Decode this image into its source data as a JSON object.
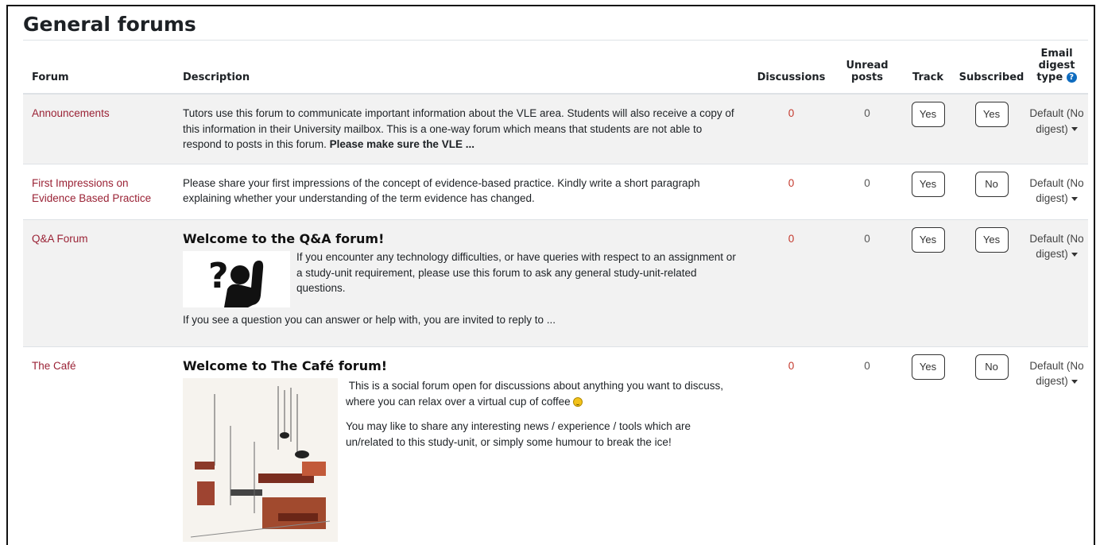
{
  "section_title": "General forums",
  "columns": {
    "forum": "Forum",
    "description": "Description",
    "discussions": "Discussions",
    "unread_line1": "Unread",
    "unread_line2": "posts",
    "track": "Track",
    "subscribed": "Subscribed",
    "digest_line1": "Email digest",
    "digest_line2": "type",
    "digest_help_icon": "question-circle-icon"
  },
  "forums": [
    {
      "name": "Announcements",
      "description_text": "Tutors use this forum to communicate important information about the VLE area. Students will also receive a copy of this information in their University mailbox. This is a one-way forum which means that students are not able to respond to posts in this forum.",
      "description_bold": "Please make sure the VLE ...",
      "discussions": "0",
      "unread": "0",
      "track": "Yes",
      "subscribed": "Yes",
      "digest": "Default (No digest)"
    },
    {
      "name": "First Impressions on Evidence Based Practice",
      "description_text": "Please share your first impressions of the concept of evidence-based practice. Kindly write a short paragraph explaining whether your understanding of the term evidence has changed.",
      "discussions": "0",
      "unread": "0",
      "track": "Yes",
      "subscribed": "No",
      "digest": "Default (No digest)"
    },
    {
      "name": "Q&A Forum",
      "heading": "Welcome to the Q&A forum!",
      "side_text": "If you encounter any technology difficulties, or have queries with respect to an assignment or a study-unit requirement, please use this forum to ask any general study-unit-related questions.",
      "footer_text": "If you see a question you can answer or help with, you are invited to reply to ...",
      "image_icon": "question-person-raising-hand-icon",
      "discussions": "0",
      "unread": "0",
      "track": "Yes",
      "subscribed": "Yes",
      "digest": "Default (No digest)"
    },
    {
      "name": "The Café",
      "heading": "Welcome to The Café forum!",
      "para1": "This is a social forum open for discussions about anything you want to discuss, where you can relax over a virtual cup of coffee",
      "para2": "You may like to share any interesting news / experience / tools which are un/related to this study-unit, or simply some humour to break the ice!",
      "image_icon": "cafe-sketch-image",
      "discussions": "0",
      "unread": "0",
      "track": "Yes",
      "subscribed": "No",
      "digest": "Default (No digest)"
    }
  ]
}
